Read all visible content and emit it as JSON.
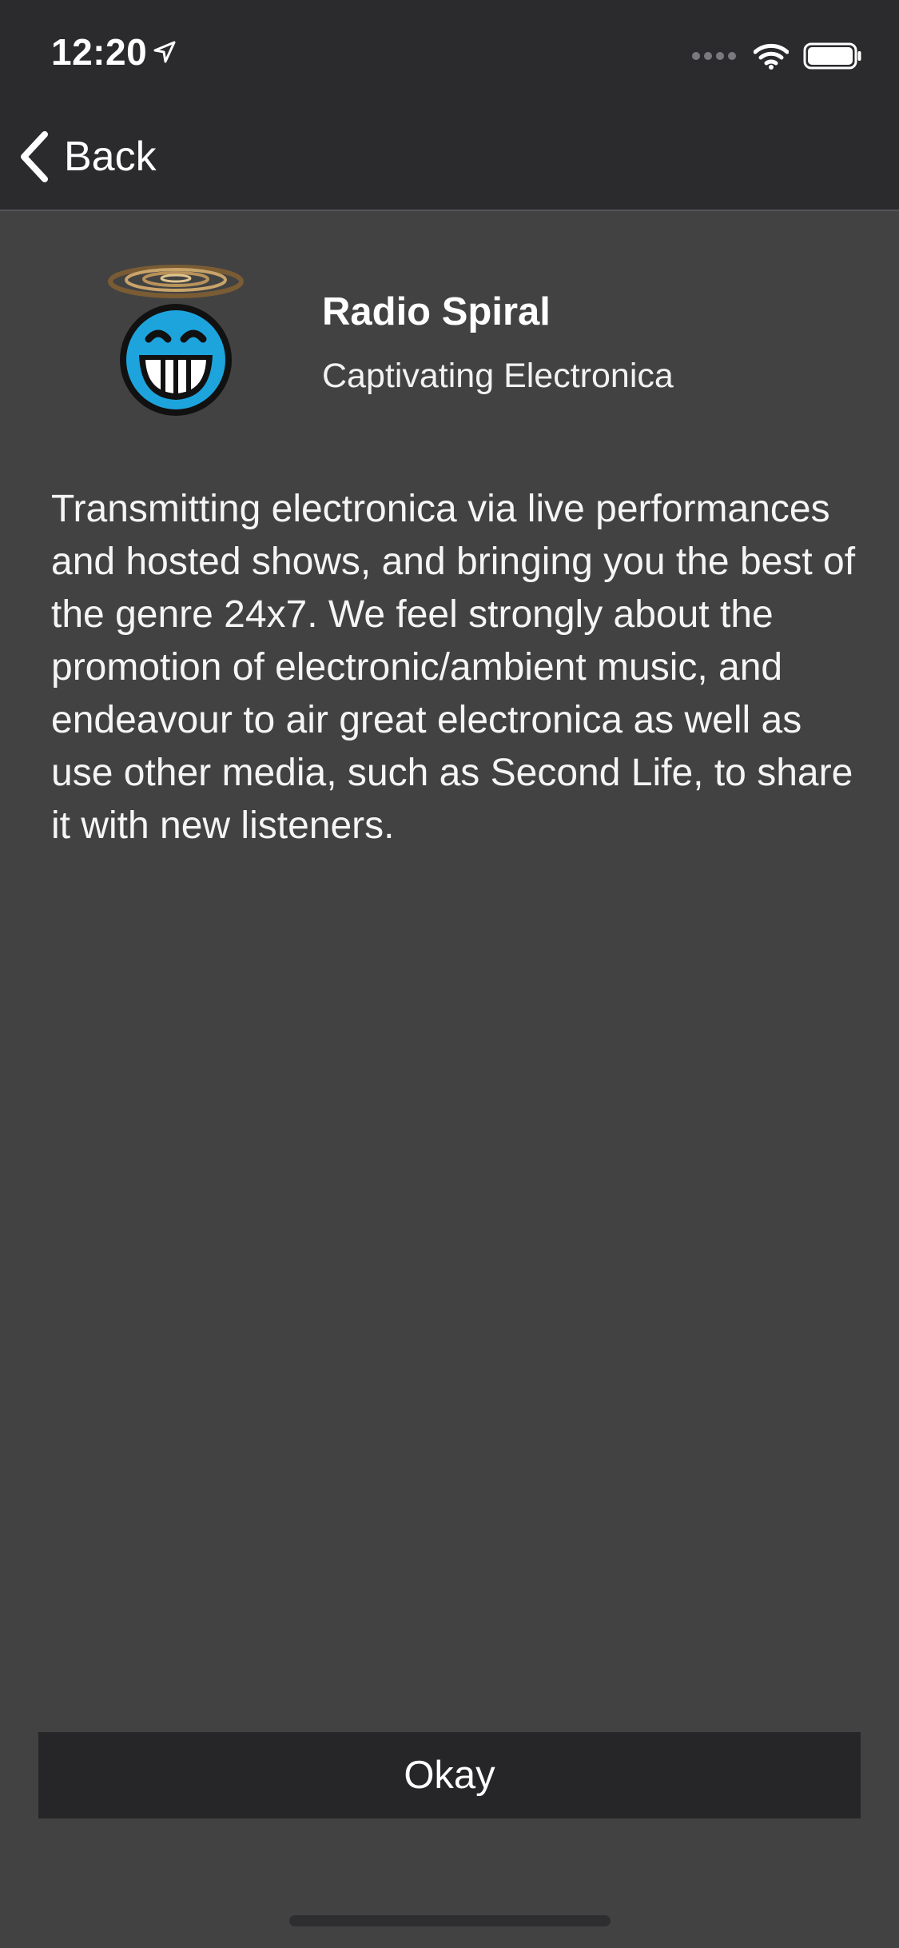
{
  "status_bar": {
    "time": "12:20",
    "location_icon": "location-arrow-icon",
    "signal_icon": "signal-dots-icon",
    "wifi_icon": "wifi-icon",
    "battery_icon": "battery-icon"
  },
  "nav": {
    "back_label": "Back",
    "back_icon": "chevron-left-icon"
  },
  "station": {
    "logo": "halo-grinning-face-logo",
    "name": "Radio Spiral",
    "tagline": "Captivating Electronica",
    "description": "Transmitting electronica via live performances and hosted shows, and bringing you the best of the genre 24x7. We feel strongly about the promotion of electronic/ambient music, and endeavour to air great electronica as well as use other media, such as Second Life, to share it with new listeners."
  },
  "actions": {
    "okay_label": "Okay"
  },
  "colors": {
    "background": "#424242",
    "nav_bar": "#2b2b2e",
    "button": "#262628",
    "logo_blue": "#1ea4dc",
    "halo_gold": "#b8925a"
  }
}
